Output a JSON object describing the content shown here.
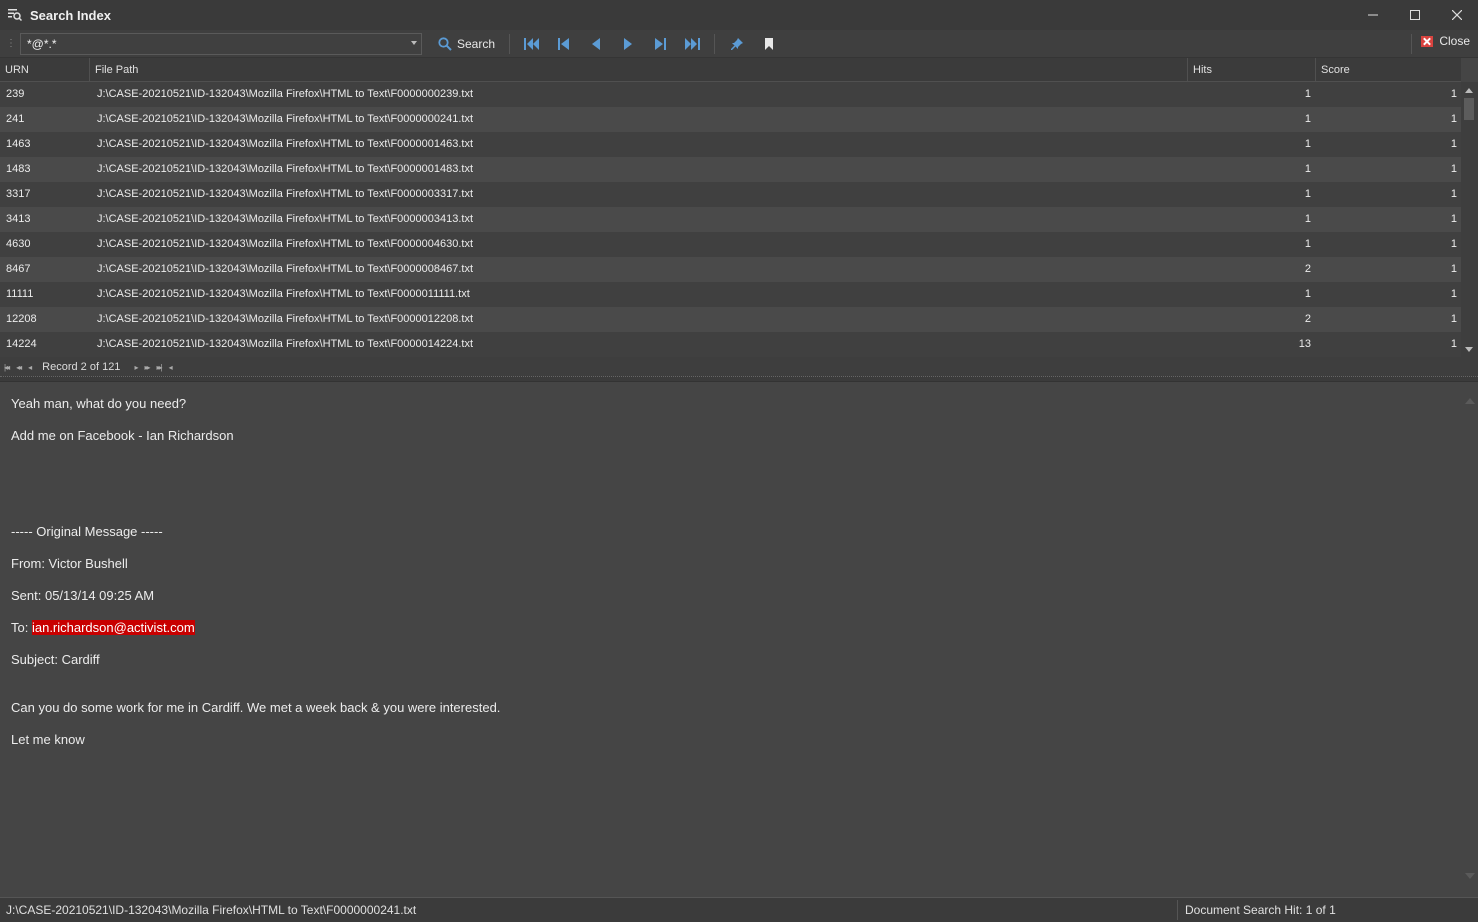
{
  "window": {
    "title": "Search Index",
    "icon": "search-list-icon",
    "controls": [
      "minimize-icon",
      "maximize-icon",
      "close-icon"
    ]
  },
  "toolbar": {
    "search_value": "*@*.*",
    "search_label": "Search",
    "close_label": "Close",
    "nav_icons": [
      "first-icon",
      "previous-page-icon",
      "previous-icon",
      "next-icon",
      "next-page-icon",
      "last-icon"
    ],
    "pin_icon": "pin-icon",
    "bookmark_icon": "bookmark-icon",
    "accent_color": "#5b9bd5",
    "close_color": "#d9433f"
  },
  "grid": {
    "columns": [
      "URN",
      "File Path",
      "Hits",
      "Score"
    ],
    "rows": [
      {
        "urn": "239",
        "path": "J:\\CASE-20210521\\ID-132043\\Mozilla Firefox\\HTML to Text\\F0000000239.txt",
        "hits": "1",
        "score": "1"
      },
      {
        "urn": "241",
        "path": "J:\\CASE-20210521\\ID-132043\\Mozilla Firefox\\HTML to Text\\F0000000241.txt",
        "hits": "1",
        "score": "1"
      },
      {
        "urn": "1463",
        "path": "J:\\CASE-20210521\\ID-132043\\Mozilla Firefox\\HTML to Text\\F0000001463.txt",
        "hits": "1",
        "score": "1"
      },
      {
        "urn": "1483",
        "path": "J:\\CASE-20210521\\ID-132043\\Mozilla Firefox\\HTML to Text\\F0000001483.txt",
        "hits": "1",
        "score": "1"
      },
      {
        "urn": "3317",
        "path": "J:\\CASE-20210521\\ID-132043\\Mozilla Firefox\\HTML to Text\\F0000003317.txt",
        "hits": "1",
        "score": "1"
      },
      {
        "urn": "3413",
        "path": "J:\\CASE-20210521\\ID-132043\\Mozilla Firefox\\HTML to Text\\F0000003413.txt",
        "hits": "1",
        "score": "1"
      },
      {
        "urn": "4630",
        "path": "J:\\CASE-20210521\\ID-132043\\Mozilla Firefox\\HTML to Text\\F0000004630.txt",
        "hits": "1",
        "score": "1"
      },
      {
        "urn": "8467",
        "path": "J:\\CASE-20210521\\ID-132043\\Mozilla Firefox\\HTML to Text\\F0000008467.txt",
        "hits": "2",
        "score": "1"
      },
      {
        "urn": "11111",
        "path": "J:\\CASE-20210521\\ID-132043\\Mozilla Firefox\\HTML to Text\\F0000011111.txt",
        "hits": "1",
        "score": "1"
      },
      {
        "urn": "12208",
        "path": "J:\\CASE-20210521\\ID-132043\\Mozilla Firefox\\HTML to Text\\F0000012208.txt",
        "hits": "2",
        "score": "1"
      },
      {
        "urn": "14224",
        "path": "J:\\CASE-20210521\\ID-132043\\Mozilla Firefox\\HTML to Text\\F0000014224.txt",
        "hits": "13",
        "score": "1"
      }
    ]
  },
  "navigator": {
    "record_text": "Record 2 of 121"
  },
  "document": {
    "lines": [
      "Yeah man, what do you need?",
      "Add me on Facebook - Ian Richardson",
      "----- Original Message -----",
      "From: Victor Bushell",
      "Sent: 05/13/14 09:25 AM",
      "Subject: Cardiff",
      "Can you do some work for me in Cardiff.  We met a week back & you were interested.",
      "Let me know"
    ],
    "to_prefix": "To: ",
    "to_highlight": "ian.richardson@activist.com",
    "highlight_color": "#c80000"
  },
  "status": {
    "path": "J:\\CASE-20210521\\ID-132043\\Mozilla Firefox\\HTML to Text\\F0000000241.txt",
    "hit_text": "Document Search Hit: 1 of 1"
  }
}
